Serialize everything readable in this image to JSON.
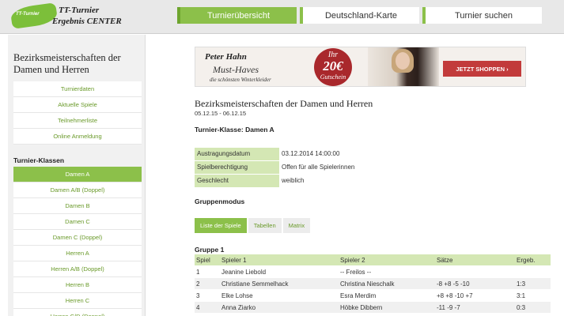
{
  "header": {
    "logo": {
      "badge": "TT-Turnier",
      "line1": "TT-Turnier",
      "line2": "Ergebnis CENTER"
    },
    "nav": [
      "Turnierübersicht",
      "Deutschland-Karte",
      "Turnier suchen"
    ]
  },
  "sidebar": {
    "title": "Bezirksmeisterschaften der Damen und Herren",
    "links": [
      "Turnierdaten",
      "Aktuelle Spiele",
      "Teilnehmerliste",
      "Online Anmeldung"
    ],
    "classes_heading": "Turnier-Klassen",
    "classes": [
      "Damen A",
      "Damen A/B (Doppel)",
      "Damen B",
      "Damen C",
      "Damen C (Doppel)",
      "Herren A",
      "Herren A/B (Doppel)",
      "Herren B",
      "Herren C",
      "Herren C/D (Doppel)"
    ]
  },
  "ad": {
    "brand": "Peter Hahn",
    "headline": "Must-Haves",
    "sub": "die schönsten Winterkleider",
    "badge_top": "Ihr",
    "badge_amount": "20€",
    "badge_bottom": "Gutschein",
    "cta": "JETZT SHOPPEN ›"
  },
  "main": {
    "title": "Bezirksmeisterschaften der Damen und Herren",
    "dates": "05.12.15 - 06.12.15",
    "klasse": "Turnier-Klasse: Damen A",
    "info": [
      {
        "key": "Austragungsdatum",
        "value": "03.12.2014 14:00:00"
      },
      {
        "key": "Spielberechtigung",
        "value": "Offen für alle Spielerinnen"
      },
      {
        "key": "Geschlecht",
        "value": "weiblich"
      }
    ],
    "mode_heading": "Gruppenmodus",
    "view_tabs": [
      "Liste der Spiele",
      "Tabellen",
      "Matrix"
    ],
    "group_heading": "Gruppe 1",
    "table": {
      "headers": [
        "Spiel",
        "Spieler 1",
        "Spieler 2",
        "Sätze",
        "Ergeb."
      ],
      "rows": [
        [
          "1",
          "Jeanine Liebold",
          "-- Freilos --",
          "",
          ""
        ],
        [
          "2",
          "Christiane Semmelhack",
          "Christina Nieschalk",
          "-8 +8 -5 -10",
          "1:3"
        ],
        [
          "3",
          "Elke Lohse",
          "Esra Merdim",
          "+8 +8 -10 +7",
          "3:1"
        ],
        [
          "4",
          "Anna Ziarko",
          "Höbke Dibbern",
          "-11 -9 -7",
          "0:3"
        ]
      ]
    }
  },
  "colors": {
    "accent": "#8cc04a",
    "accent_light": "#d4e7b4",
    "ad_red": "#c23b3b"
  }
}
